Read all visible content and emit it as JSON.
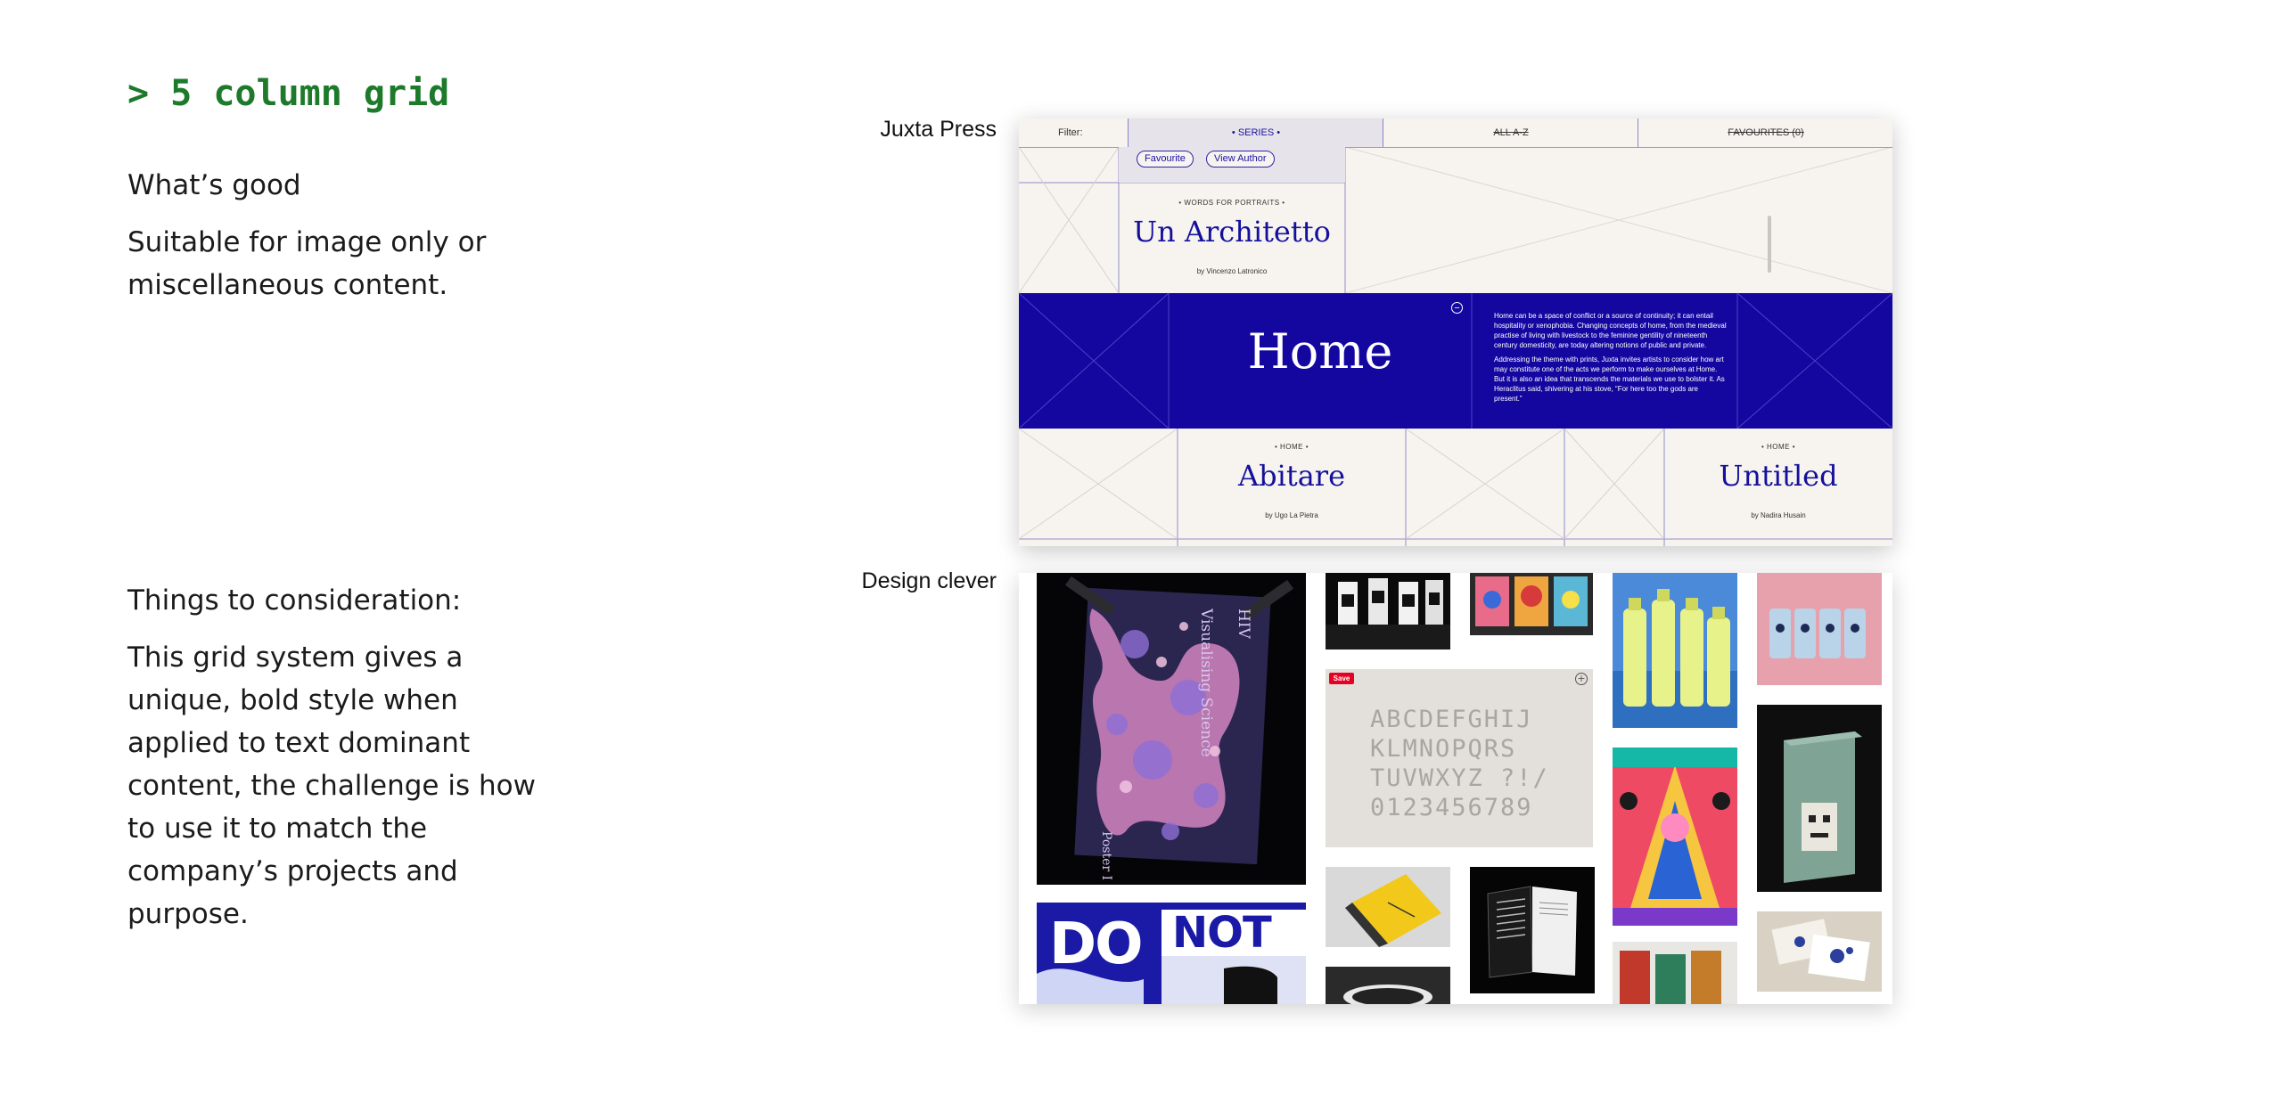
{
  "heading": "> 5 column grid",
  "good": {
    "title": "What’s good",
    "lines": [
      "Suitable for image only or",
      "miscellaneous content."
    ]
  },
  "consider": {
    "title": "Things to consideration:",
    "lines": [
      "This grid system gives a",
      "unique, bold style when",
      "applied to text dominant",
      "content, the challenge is how",
      "to use it to match the",
      "company’s projects and",
      "purpose."
    ]
  },
  "examples": {
    "juxta_label": "Juxta Press",
    "clever_label": "Design clever"
  },
  "juxta": {
    "filter_label": "Filter:",
    "tabs": [
      "• SERIES •",
      "ALL A-Z",
      "FAVOURITES (0)"
    ],
    "favourite_button": "Favourite",
    "view_author_button": "View Author",
    "book1": {
      "kicker": "• WORDS FOR PORTRAITS •",
      "title": "Un Architetto",
      "author": "by Vincenzo Latronico"
    },
    "home_title": "Home",
    "collapse_symbol": "−",
    "home_paragraph_1": "Home can be a space of conflict or a source of continuity; it can entail hospitality or xenophobia. Changing concepts of home, from the medieval practise of living with livestock to the feminine gentility of nineteenth century domesticity, are today altering notions of public and private.",
    "home_paragraph_2": "Addressing the theme with prints, Juxta invites artists to consider how art may constitute one of the acts we perform to make ourselves at Home. But it is also an idea that transcends the materials we use to bolster it. As Heraclitus said, shivering at his stove, “For here too the gods are present.”",
    "book2": {
      "kicker": "• HOME •",
      "title": "Abitare",
      "author": "by Ugo La Pietra"
    },
    "book3": {
      "kicker": "• HOME •",
      "title": "Untitled",
      "author": "by Nadira Husain"
    }
  },
  "clever": {
    "poster_text_1": "Visualising Science",
    "poster_text_2": "HIV",
    "poster_text_3": "Poster I",
    "save_badge": "Save",
    "alphabet": [
      "ABCDEFGHIJ",
      "KLMNOPQRS",
      "TUVWXYZ ?!/",
      "0123456789"
    ],
    "do_not_text": [
      "DO",
      "NOT"
    ]
  }
}
